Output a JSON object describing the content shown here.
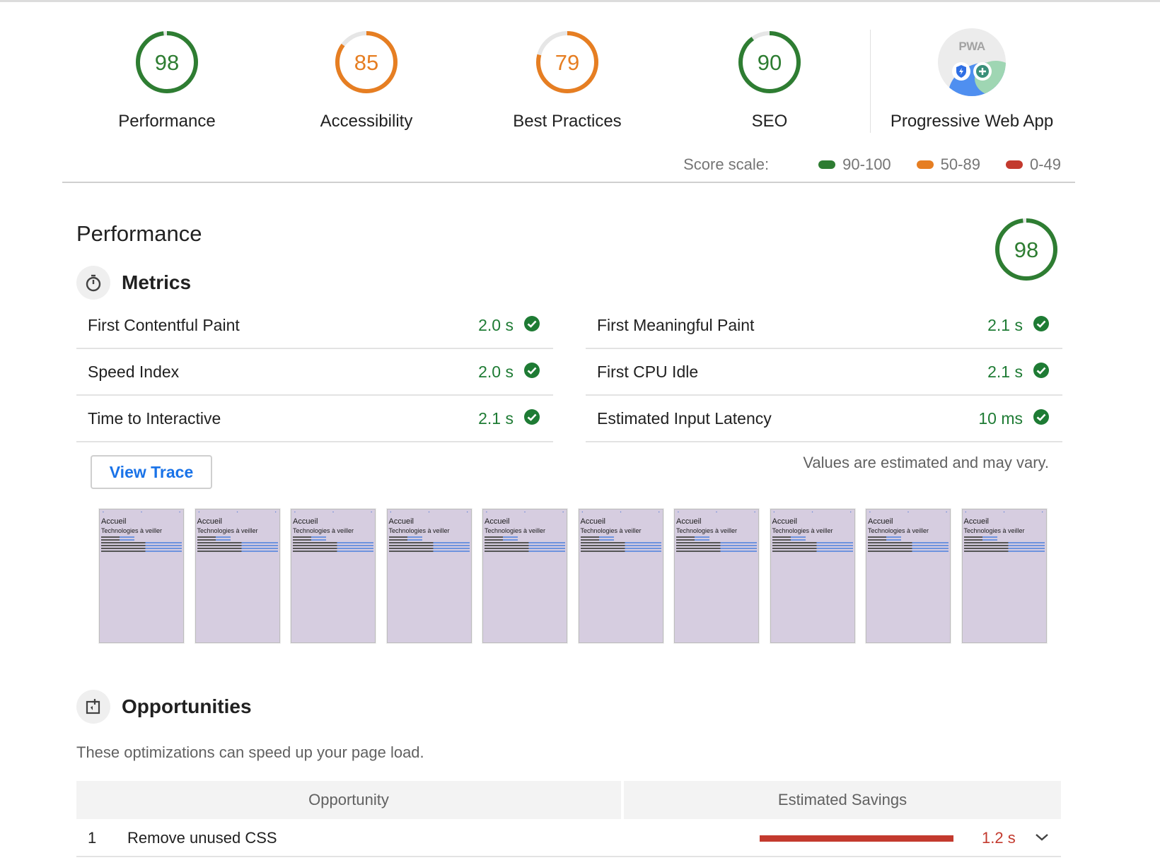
{
  "categories": [
    {
      "score": "98",
      "label": "Performance",
      "value": 98,
      "color": "#2e7d32"
    },
    {
      "score": "85",
      "label": "Accessibility",
      "value": 85,
      "color": "#e67e22"
    },
    {
      "score": "79",
      "label": "Best Practices",
      "value": 79,
      "color": "#e67e22"
    },
    {
      "score": "90",
      "label": "SEO",
      "value": 90,
      "color": "#2e7d32"
    }
  ],
  "pwa": {
    "badge_text": "PWA",
    "label": "Progressive Web App"
  },
  "scale": {
    "title": "Score scale:",
    "ranges": [
      {
        "label": "90-100",
        "color": "#2e7d32"
      },
      {
        "label": "50-89",
        "color": "#e67e22"
      },
      {
        "label": "0-49",
        "color": "#c33a2e"
      }
    ]
  },
  "performance": {
    "title": "Performance",
    "score": "98",
    "score_value": 98,
    "metrics_title": "Metrics",
    "metrics": [
      {
        "name": "First Contentful Paint",
        "value": "2.0 s"
      },
      {
        "name": "First Meaningful Paint",
        "value": "2.1 s"
      },
      {
        "name": "Speed Index",
        "value": "2.0 s"
      },
      {
        "name": "First CPU Idle",
        "value": "2.1 s"
      },
      {
        "name": "Time to Interactive",
        "value": "2.1 s"
      },
      {
        "name": "Estimated Input Latency",
        "value": "10 ms"
      }
    ],
    "view_trace": "View Trace",
    "vary_note": "Values are estimated and may vary.",
    "filmstrip": {
      "frame_title": "Accueil",
      "frame_subtitle": "Technologies à veiller",
      "frame_count": 10
    }
  },
  "opportunities": {
    "title": "Opportunities",
    "description": "These optimizations can speed up your page load.",
    "col_opportunity": "Opportunity",
    "col_savings": "Estimated Savings",
    "rows": [
      {
        "index": "1",
        "name": "Remove unused CSS",
        "savings": "1.2 s"
      }
    ]
  }
}
